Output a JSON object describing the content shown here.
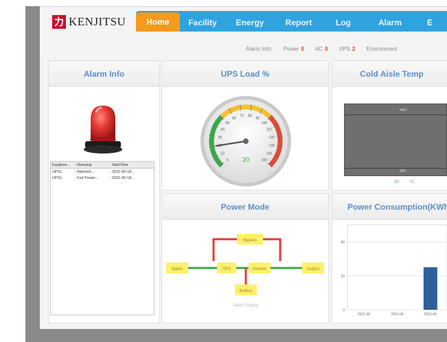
{
  "brand": {
    "logo_mark": "力",
    "name": "KENJITSU"
  },
  "nav": {
    "items": [
      {
        "label": "Home",
        "active": true
      },
      {
        "label": "Facility",
        "active": false
      },
      {
        "label": "Energy",
        "active": false
      },
      {
        "label": "Report",
        "active": false
      },
      {
        "label": "Log",
        "active": false
      },
      {
        "label": "Alarm",
        "active": false
      },
      {
        "label": "E",
        "active": false
      }
    ]
  },
  "status_bar": {
    "label": "Alarm Info:",
    "items": [
      {
        "label": "Power",
        "count": "0"
      },
      {
        "label": "AC",
        "count": "0"
      },
      {
        "label": "UPS",
        "count": "2"
      },
      {
        "label": "Environment",
        "count": ""
      }
    ]
  },
  "panels": {
    "alarm": {
      "title": "Alarm Info",
      "columns": [
        "Equipme...",
        "Meaning",
        "StartTime"
      ],
      "rows": [
        [
          "UPS1",
          "Alarmed...",
          "2021-06-18..."
        ],
        [
          "UPS1",
          "Fed Power...",
          "2021-06-18..."
        ]
      ]
    },
    "ups_load": {
      "title": "UPS Load %",
      "ticks": [
        "0",
        "10",
        "20",
        "30",
        "40",
        "50",
        "60",
        "70",
        "80",
        "90",
        "100",
        "110",
        "120",
        "130",
        "140",
        "150"
      ],
      "value_label": "20",
      "value": 20
    },
    "cold_aisle": {
      "title": "Cold Aisle Temp",
      "top_label": "MAX",
      "bottom_label": "MIN",
      "legend": [
        "30",
        "°C"
      ]
    },
    "power_mode": {
      "title": "Power Mode",
      "nodes": {
        "bypass": "Bypass",
        "mains": "Mains",
        "ups": "UPS",
        "inverter": "Inverter",
        "output": "Output",
        "battery": "Battery"
      },
      "caption": "Mains Supply"
    },
    "power_consumption": {
      "title": "Power Consumption(KWh)"
    }
  },
  "chart_data": {
    "type": "bar",
    "title": "Power Consumption(KWh)",
    "categories": [
      "2021-02",
      "2021-04",
      "2021-06"
    ],
    "values": [
      0,
      0,
      25
    ],
    "y_ticks": [
      "0",
      "20",
      "40"
    ],
    "ylim": [
      0,
      50
    ],
    "grid": true
  },
  "colors": {
    "nav_bg": "#2fa3e0",
    "nav_active": "#f59a1a",
    "panel_title": "#5b8fc7",
    "line_green": "#3aa84a",
    "line_red": "#e53935",
    "node_yellow": "#fff06a"
  }
}
